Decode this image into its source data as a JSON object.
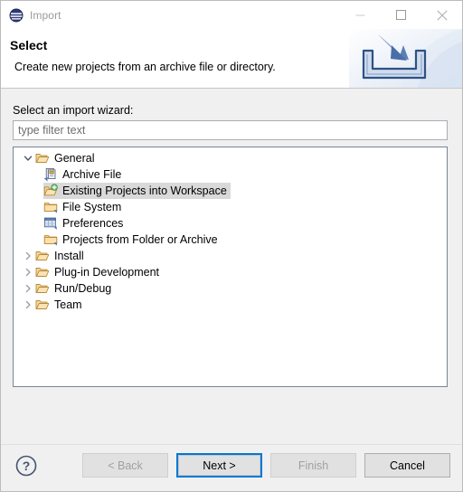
{
  "window": {
    "title": "Import",
    "app_icon": "eclipse-globe-icon",
    "controls": {
      "minimize": "minimize-icon",
      "maximize": "maximize-icon",
      "close": "close-icon"
    }
  },
  "header": {
    "title": "Select",
    "description": "Create new projects from an archive file or directory.",
    "banner_icon": "import-arrow-icon"
  },
  "form": {
    "label": "Select an import wizard:",
    "filter": {
      "value": "",
      "placeholder": "type filter text"
    }
  },
  "tree": {
    "items": [
      {
        "label": "General",
        "icon": "open-folder-icon",
        "twisty": "chevron-down-icon",
        "level": 0,
        "expanded": true,
        "selected": false
      },
      {
        "label": "Archive File",
        "icon": "archive-file-icon",
        "twisty": "none",
        "level": 1,
        "expanded": false,
        "selected": false
      },
      {
        "label": "Existing Projects into Workspace",
        "icon": "import-projects-folder-icon",
        "twisty": "none",
        "level": 1,
        "expanded": false,
        "selected": true
      },
      {
        "label": "File System",
        "icon": "folder-icon",
        "twisty": "none",
        "level": 1,
        "expanded": false,
        "selected": false
      },
      {
        "label": "Preferences",
        "icon": "preferences-table-icon",
        "twisty": "none",
        "level": 1,
        "expanded": false,
        "selected": false
      },
      {
        "label": "Projects from Folder or Archive",
        "icon": "folder-icon",
        "twisty": "none",
        "level": 1,
        "expanded": false,
        "selected": false
      },
      {
        "label": "Install",
        "icon": "open-folder-icon",
        "twisty": "chevron-right-icon",
        "level": 0,
        "expanded": false,
        "selected": false
      },
      {
        "label": "Plug-in Development",
        "icon": "open-folder-icon",
        "twisty": "chevron-right-icon",
        "level": 0,
        "expanded": false,
        "selected": false
      },
      {
        "label": "Run/Debug",
        "icon": "open-folder-icon",
        "twisty": "chevron-right-icon",
        "level": 0,
        "expanded": false,
        "selected": false
      },
      {
        "label": "Team",
        "icon": "open-folder-icon",
        "twisty": "chevron-right-icon",
        "level": 0,
        "expanded": false,
        "selected": false
      }
    ]
  },
  "footer": {
    "help_icon": "help-question-icon",
    "buttons": [
      {
        "label": "< Back",
        "state": "disabled",
        "name": "back-button"
      },
      {
        "label": "Next >",
        "state": "default",
        "name": "next-button"
      },
      {
        "label": "Finish",
        "state": "disabled",
        "name": "finish-button"
      },
      {
        "label": "Cancel",
        "state": "enabled",
        "name": "cancel-button"
      }
    ]
  },
  "colors": {
    "accent": "#0078d7",
    "window_bg": "#f0f0f0",
    "panel_bg": "#ffffff",
    "selection": "#d9d9d9",
    "folder": "#f7c873"
  }
}
